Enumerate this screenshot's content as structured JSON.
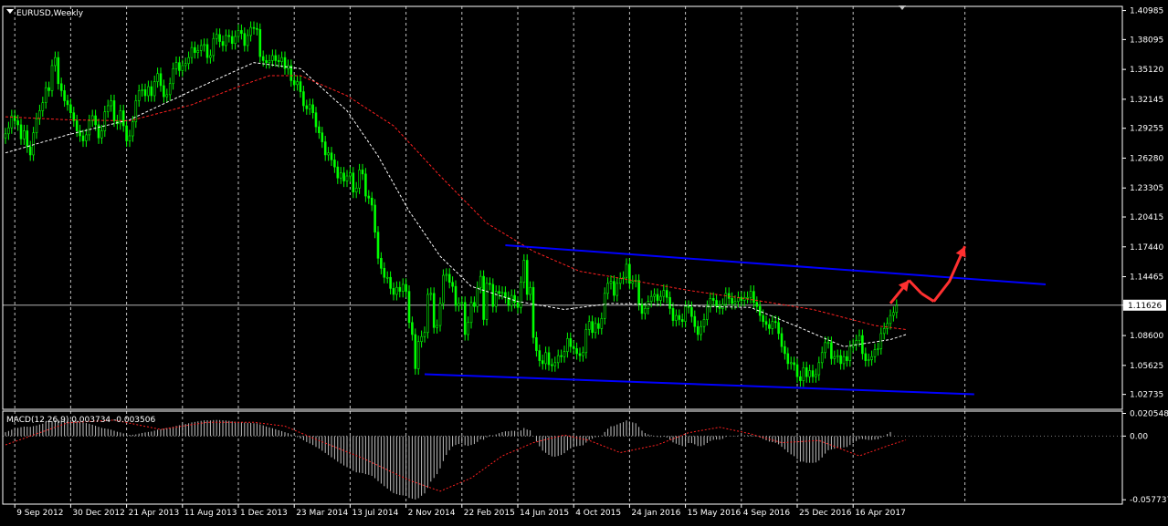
{
  "chart_data": {
    "type": "candlestick",
    "symbol_title": "EURUSD,Weekly",
    "current_price": "1.11626",
    "price_axis": {
      "ylim": [
        1.0125,
        1.414
      ],
      "tick_labels": [
        "1.40985",
        "1.38095",
        "1.35120",
        "1.32145",
        "1.29255",
        "1.26280",
        "1.23305",
        "1.20415",
        "1.17440",
        "1.14465",
        "1.11626",
        "1.08600",
        "1.05625",
        "1.02735"
      ]
    },
    "time_axis": {
      "labels": [
        "9 Sep 2012",
        "30 Dec 2012",
        "21 Apr 2013",
        "11 Aug 2013",
        "1 Dec 2013",
        "23 Mar 2014",
        "13 Jul 2014",
        "2 Nov 2014",
        "22 Feb 2015",
        "14 Jun 2015",
        "4 Oct 2015",
        "24 Jan 2016",
        "15 May 2016",
        "4 Sep 2016",
        "25 Dec 2016",
        "16 Apr 2017"
      ]
    },
    "weekly_closes": [
      1.287,
      1.293,
      1.305,
      1.3,
      1.296,
      1.282,
      1.29,
      1.274,
      1.266,
      1.288,
      1.302,
      1.31,
      1.318,
      1.333,
      1.33,
      1.355,
      1.363,
      1.337,
      1.33,
      1.32,
      1.316,
      1.308,
      1.3,
      1.29,
      1.285,
      1.28,
      1.286,
      1.3,
      1.305,
      1.296,
      1.283,
      1.29,
      1.309,
      1.315,
      1.32,
      1.3,
      1.297,
      1.31,
      1.295,
      1.28,
      1.285,
      1.299,
      1.32,
      1.33,
      1.331,
      1.325,
      1.334,
      1.325,
      1.339,
      1.347,
      1.335,
      1.324,
      1.326,
      1.337,
      1.352,
      1.358,
      1.35,
      1.355,
      1.357,
      1.363,
      1.373,
      1.368,
      1.37,
      1.375,
      1.376,
      1.363,
      1.365,
      1.382,
      1.386,
      1.379,
      1.375,
      1.385,
      1.384,
      1.377,
      1.384,
      1.39,
      1.387,
      1.375,
      1.385,
      1.393,
      1.392,
      1.391,
      1.364,
      1.36,
      1.358,
      1.36,
      1.365,
      1.36,
      1.359,
      1.363,
      1.352,
      1.355,
      1.34,
      1.336,
      1.339,
      1.329,
      1.315,
      1.312,
      1.316,
      1.308,
      1.294,
      1.288,
      1.279,
      1.266,
      1.268,
      1.261,
      1.254,
      1.243,
      1.248,
      1.24,
      1.245,
      1.248,
      1.229,
      1.233,
      1.251,
      1.247,
      1.225,
      1.223,
      1.216,
      1.189,
      1.163,
      1.153,
      1.144,
      1.144,
      1.133,
      1.127,
      1.134,
      1.13,
      1.137,
      1.13,
      1.099,
      1.087,
      1.053,
      1.08,
      1.085,
      1.089,
      1.127,
      1.128,
      1.094,
      1.096,
      1.118,
      1.146,
      1.147,
      1.139,
      1.135,
      1.116,
      1.118,
      1.119,
      1.087,
      1.099,
      1.119,
      1.115,
      1.134,
      1.145,
      1.102,
      1.138,
      1.137,
      1.115,
      1.13,
      1.128,
      1.129,
      1.124,
      1.116,
      1.126,
      1.119,
      1.114,
      1.139,
      1.161,
      1.127,
      1.134,
      1.084,
      1.071,
      1.061,
      1.058,
      1.069,
      1.057,
      1.056,
      1.059,
      1.066,
      1.065,
      1.07,
      1.083,
      1.075,
      1.073,
      1.068,
      1.066,
      1.069,
      1.092,
      1.1,
      1.089,
      1.098,
      1.093,
      1.103,
      1.128,
      1.138,
      1.14,
      1.126,
      1.138,
      1.143,
      1.144,
      1.157,
      1.138,
      1.14,
      1.141,
      1.117,
      1.108,
      1.113,
      1.12,
      1.125,
      1.127,
      1.121,
      1.125,
      1.131,
      1.124,
      1.113,
      1.101,
      1.106,
      1.102,
      1.1,
      1.115,
      1.114,
      1.105,
      1.095,
      1.087,
      1.095,
      1.102,
      1.115,
      1.123,
      1.121,
      1.115,
      1.113,
      1.117,
      1.128,
      1.123,
      1.118,
      1.12,
      1.124,
      1.121,
      1.124,
      1.124,
      1.13,
      1.119,
      1.115,
      1.106,
      1.1,
      1.097,
      1.093,
      1.1,
      1.099,
      1.088,
      1.075,
      1.068,
      1.058,
      1.059,
      1.057,
      1.045,
      1.041,
      1.054,
      1.045,
      1.051,
      1.045,
      1.047,
      1.059,
      1.069,
      1.079,
      1.079,
      1.063,
      1.065,
      1.066,
      1.058,
      1.065,
      1.061,
      1.075,
      1.077,
      1.081,
      1.086,
      1.068,
      1.061,
      1.062,
      1.065,
      1.072,
      1.073,
      1.088,
      1.093,
      1.098,
      1.106,
      1.109,
      1.116
    ],
    "moving_averages": [
      {
        "color": "#ffffff",
        "style": "dashed",
        "anchors": [
          [
            0,
            1.268
          ],
          [
            20,
            1.286
          ],
          [
            40,
            1.301
          ],
          [
            60,
            1.33
          ],
          [
            80,
            1.358
          ],
          [
            95,
            1.352
          ],
          [
            110,
            1.31
          ],
          [
            120,
            1.265
          ],
          [
            130,
            1.21
          ],
          [
            140,
            1.165
          ],
          [
            150,
            1.135
          ],
          [
            165,
            1.12
          ],
          [
            180,
            1.112
          ],
          [
            195,
            1.118
          ],
          [
            210,
            1.117
          ],
          [
            225,
            1.115
          ],
          [
            240,
            1.114
          ],
          [
            255,
            1.095
          ],
          [
            270,
            1.075
          ],
          [
            285,
            1.082
          ],
          [
            290,
            1.087
          ]
        ]
      },
      {
        "color": "#ff2020",
        "style": "dashed",
        "anchors": [
          [
            0,
            1.304
          ],
          [
            20,
            1.301
          ],
          [
            40,
            1.3
          ],
          [
            60,
            1.316
          ],
          [
            75,
            1.334
          ],
          [
            85,
            1.345
          ],
          [
            95,
            1.345
          ],
          [
            110,
            1.325
          ],
          [
            125,
            1.295
          ],
          [
            140,
            1.245
          ],
          [
            155,
            1.198
          ],
          [
            170,
            1.17
          ],
          [
            185,
            1.15
          ],
          [
            200,
            1.142
          ],
          [
            220,
            1.131
          ],
          [
            240,
            1.122
          ],
          [
            260,
            1.112
          ],
          [
            280,
            1.096
          ],
          [
            290,
            1.092
          ]
        ]
      }
    ],
    "trendlines": [
      {
        "color": "#0000ff",
        "from": [
          161,
          1.176
        ],
        "to": [
          335,
          1.137
        ]
      },
      {
        "color": "#0000ff",
        "from": [
          135,
          1.0475
        ],
        "to": [
          312,
          1.0275
        ]
      }
    ],
    "horizontal_line": {
      "value": 1.11626,
      "color": "#b4b4b4"
    },
    "forecast_arrow": {
      "color": "#ff3030",
      "path": [
        [
          285,
          1.118
        ],
        [
          291,
          1.141
        ],
        [
          295,
          1.128
        ],
        [
          299,
          1.12
        ],
        [
          304,
          1.14
        ],
        [
          309,
          1.175
        ]
      ]
    },
    "macd": {
      "label": "MACD(12,26,9) 0.003734 -0.003506",
      "ylim": [
        -0.0617,
        0.0226
      ],
      "tick_labels": [
        "0.020548",
        "0.00",
        "-0.057737"
      ],
      "histogram": [
        0.0035,
        0.0046,
        0.0058,
        0.0067,
        0.0074,
        0.008,
        0.0086,
        0.0085,
        0.0083,
        0.009,
        0.0096,
        0.0105,
        0.0112,
        0.0121,
        0.0129,
        0.0134,
        0.0142,
        0.0147,
        0.0146,
        0.0148,
        0.0148,
        0.0146,
        0.0142,
        0.0138,
        0.0132,
        0.0125,
        0.0118,
        0.0111,
        0.0103,
        0.0093,
        0.0083,
        0.0074,
        0.0069,
        0.0064,
        0.0058,
        0.0048,
        0.0039,
        0.0033,
        0.0024,
        0.0016,
        0.0011,
        0.0012,
        0.0015,
        0.0022,
        0.0028,
        0.0033,
        0.0037,
        0.0041,
        0.0049,
        0.0058,
        0.0062,
        0.0067,
        0.0072,
        0.0078,
        0.0084,
        0.0092,
        0.0098,
        0.0105,
        0.0109,
        0.0116,
        0.0124,
        0.0128,
        0.0133,
        0.0138,
        0.0143,
        0.0143,
        0.0142,
        0.0145,
        0.0146,
        0.0145,
        0.0143,
        0.0141,
        0.0138,
        0.0133,
        0.013,
        0.0129,
        0.0127,
        0.0122,
        0.012,
        0.0119,
        0.0117,
        0.0116,
        0.0106,
        0.0097,
        0.0087,
        0.0078,
        0.0071,
        0.0062,
        0.0053,
        0.0045,
        0.0035,
        0.0026,
        0.0014,
        0.0001,
        -0.0009,
        -0.0022,
        -0.0038,
        -0.0054,
        -0.0067,
        -0.0081,
        -0.0098,
        -0.0114,
        -0.0133,
        -0.0153,
        -0.0172,
        -0.0192,
        -0.021,
        -0.0232,
        -0.0249,
        -0.0267,
        -0.0282,
        -0.0294,
        -0.0315,
        -0.0329,
        -0.0332,
        -0.0336,
        -0.0345,
        -0.0351,
        -0.0361,
        -0.0382,
        -0.0408,
        -0.0431,
        -0.0454,
        -0.0476,
        -0.0498,
        -0.0517,
        -0.0527,
        -0.0535,
        -0.0538,
        -0.0542,
        -0.0561,
        -0.0568,
        -0.0575,
        -0.0563,
        -0.0541,
        -0.052,
        -0.047,
        -0.0413,
        -0.038,
        -0.0345,
        -0.0294,
        -0.0227,
        -0.0171,
        -0.0128,
        -0.0094,
        -0.0081,
        -0.0072,
        -0.0066,
        -0.0083,
        -0.0089,
        -0.0081,
        -0.0072,
        -0.0053,
        -0.003,
        -0.0033,
        -0.0012,
        0.0009,
        0.0006,
        0.0015,
        0.0026,
        0.0036,
        0.0043,
        0.0043,
        0.0048,
        0.0047,
        0.004,
        0.0051,
        0.0073,
        0.0059,
        0.0052,
        0.0002,
        -0.0049,
        -0.0093,
        -0.0132,
        -0.0152,
        -0.0171,
        -0.0184,
        -0.0187,
        -0.018,
        -0.0171,
        -0.0155,
        -0.013,
        -0.0112,
        -0.0099,
        -0.0092,
        -0.0088,
        -0.0083,
        -0.006,
        -0.0034,
        -0.0024,
        -0.0011,
        -0.0007,
        0.0005,
        0.0037,
        0.0066,
        0.0089,
        0.0091,
        0.0105,
        0.0117,
        0.0126,
        0.0141,
        0.0132,
        0.0124,
        0.0116,
        0.0083,
        0.0049,
        0.0027,
        0.0015,
        0.0008,
        0.0003,
        -0.0007,
        -0.0009,
        -0.0005,
        -0.0013,
        -0.0033,
        -0.0057,
        -0.0069,
        -0.008,
        -0.009,
        -0.0074,
        -0.0063,
        -0.0064,
        -0.0075,
        -0.009,
        -0.0091,
        -0.0082,
        -0.0063,
        -0.0045,
        -0.0034,
        -0.0031,
        -0.0032,
        -0.0025,
        -0.0007,
        -0.0001,
        0.0002,
        0.0003,
        0.0005,
        0.0005,
        0.0006,
        0.0007,
        0.001,
        0.0004,
        -0.0004,
        -0.0014,
        -0.0026,
        -0.0038,
        -0.005,
        -0.0055,
        -0.0061,
        -0.0075,
        -0.0097,
        -0.012,
        -0.0147,
        -0.0166,
        -0.0182,
        -0.0209,
        -0.0232,
        -0.0232,
        -0.0242,
        -0.0242,
        -0.0243,
        -0.0239,
        -0.0222,
        -0.0194,
        -0.0159,
        -0.0128,
        -0.0122,
        -0.0115,
        -0.0108,
        -0.0109,
        -0.0103,
        -0.0099,
        -0.0081,
        -0.0063,
        -0.0045,
        -0.0026,
        -0.0026,
        -0.0031,
        -0.0035,
        -0.0035,
        -0.0031,
        -0.0029,
        -0.0015,
        0.0002,
        0.0019,
        0.0037
      ],
      "signal_anchors": [
        [
          0,
          -0.008
        ],
        [
          10,
          0.002
        ],
        [
          20,
          0.012
        ],
        [
          35,
          0.0145
        ],
        [
          50,
          0.006
        ],
        [
          65,
          0.0125
        ],
        [
          80,
          0.0125
        ],
        [
          90,
          0.009
        ],
        [
          100,
          -0.003
        ],
        [
          115,
          -0.02
        ],
        [
          130,
          -0.04
        ],
        [
          140,
          -0.05
        ],
        [
          150,
          -0.038
        ],
        [
          160,
          -0.018
        ],
        [
          170,
          -0.006
        ],
        [
          180,
          0.001
        ],
        [
          188,
          -0.004
        ],
        [
          198,
          -0.015
        ],
        [
          210,
          -0.008
        ],
        [
          220,
          0.003
        ],
        [
          230,
          0.008
        ],
        [
          240,
          0.002
        ],
        [
          250,
          -0.006
        ],
        [
          262,
          -0.004
        ],
        [
          275,
          -0.018
        ],
        [
          285,
          -0.008
        ],
        [
          290,
          -0.0035
        ]
      ]
    }
  },
  "colors": {
    "up": "#00ff00",
    "down": "#00ff00",
    "grid": "#c0c0c0",
    "frame": "#ffffff"
  }
}
